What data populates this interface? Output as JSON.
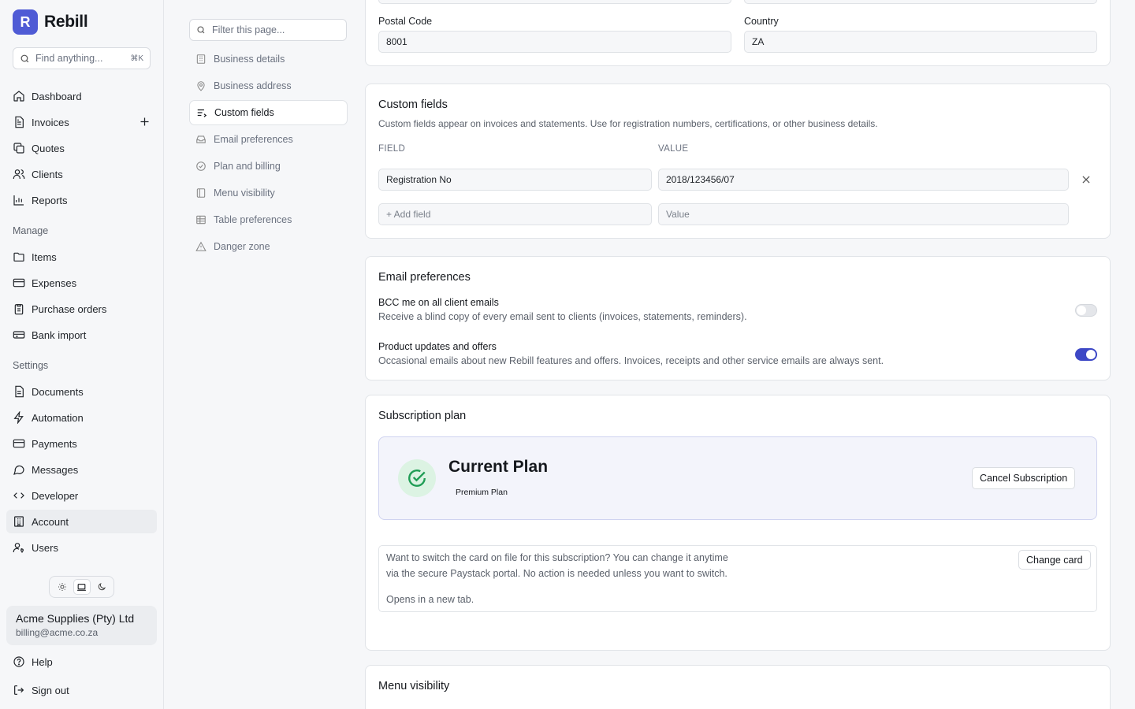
{
  "brand": {
    "logo_letter": "R",
    "name": "Rebill",
    "accent": "#4f5bd5"
  },
  "sidebar": {
    "search_placeholder": "Find anything...",
    "search_shortcut": "⌘K",
    "main_items": [
      {
        "label": "Dashboard",
        "icon": "home-icon"
      },
      {
        "label": "Invoices",
        "icon": "invoice-icon"
      },
      {
        "label": "Quotes",
        "icon": "copy-icon"
      },
      {
        "label": "Clients",
        "icon": "users-icon"
      },
      {
        "label": "Reports",
        "icon": "chart-icon"
      }
    ],
    "manage_heading": "Manage",
    "manage_items": [
      {
        "label": "Items",
        "icon": "folder-icon"
      },
      {
        "label": "Expenses",
        "icon": "credit-card-icon"
      },
      {
        "label": "Purchase orders",
        "icon": "clipboard-icon"
      },
      {
        "label": "Bank import",
        "icon": "bank-icon"
      }
    ],
    "settings_heading": "Settings",
    "settings_items": [
      {
        "label": "Documents",
        "icon": "document-icon"
      },
      {
        "label": "Automation",
        "icon": "lightning-icon"
      },
      {
        "label": "Payments",
        "icon": "credit-card-icon"
      },
      {
        "label": "Messages",
        "icon": "message-icon"
      },
      {
        "label": "Developer",
        "icon": "code-icon"
      },
      {
        "label": "Account",
        "icon": "building-icon",
        "active": true
      },
      {
        "label": "Users",
        "icon": "user-key-icon"
      }
    ],
    "theme_options": [
      "sun-icon",
      "laptop-icon",
      "moon-icon"
    ],
    "theme_active": "laptop-icon",
    "org": {
      "name": "Acme Supplies (Pty) Ltd",
      "email": "billing@acme.co.za"
    },
    "help_label": "Help",
    "signout_label": "Sign out"
  },
  "subnav": {
    "filter_placeholder": "Filter this page...",
    "items": [
      {
        "label": "Business details",
        "icon": "building-icon"
      },
      {
        "label": "Business address",
        "icon": "map-pin-icon"
      },
      {
        "label": "Custom fields",
        "icon": "list-edit-icon",
        "active": true
      },
      {
        "label": "Email preferences",
        "icon": "inbox-icon"
      },
      {
        "label": "Plan and billing",
        "icon": "check-circle-icon"
      },
      {
        "label": "Menu visibility",
        "icon": "sidebar-icon"
      },
      {
        "label": "Table preferences",
        "icon": "table-icon"
      },
      {
        "label": "Danger zone",
        "icon": "warning-icon"
      }
    ]
  },
  "address": {
    "postal_code_label": "Postal Code",
    "postal_code_value": "8001",
    "country_label": "Country",
    "country_value": "ZA"
  },
  "custom_fields": {
    "title": "Custom fields",
    "description": "Custom fields appear on invoices and statements. Use for registration numbers, certifications, or other business details.",
    "field_header": "FIELD",
    "value_header": "VALUE",
    "rows": [
      {
        "field": "Registration No",
        "value": "2018/123456/07"
      }
    ],
    "new_field_placeholder": "+ Add field",
    "new_value_placeholder": "Value"
  },
  "email_prefs": {
    "title": "Email preferences",
    "options": [
      {
        "title": "BCC me on all client emails",
        "description": "Receive a blind copy of every email sent to clients (invoices, statements, reminders).",
        "enabled": false
      },
      {
        "title": "Product updates and offers",
        "description": "Occasional emails about new Rebill features and offers. Invoices, receipts and other service emails are always sent.",
        "enabled": true
      }
    ],
    "toggle_on_color": "#3d48c6"
  },
  "subscription": {
    "title": "Subscription plan",
    "plan_heading": "Current Plan",
    "plan_badge": "Premium Plan",
    "cancel_label": "Cancel Subscription",
    "card_line1": "Want to switch the card on file for this subscription? You can change it anytime",
    "card_line2": "via the secure Paystack portal. No action is needed unless you want to switch.",
    "card_note": "Opens in a new tab.",
    "change_card_label": "Change card"
  },
  "menu_visibility": {
    "title": "Menu visibility"
  }
}
